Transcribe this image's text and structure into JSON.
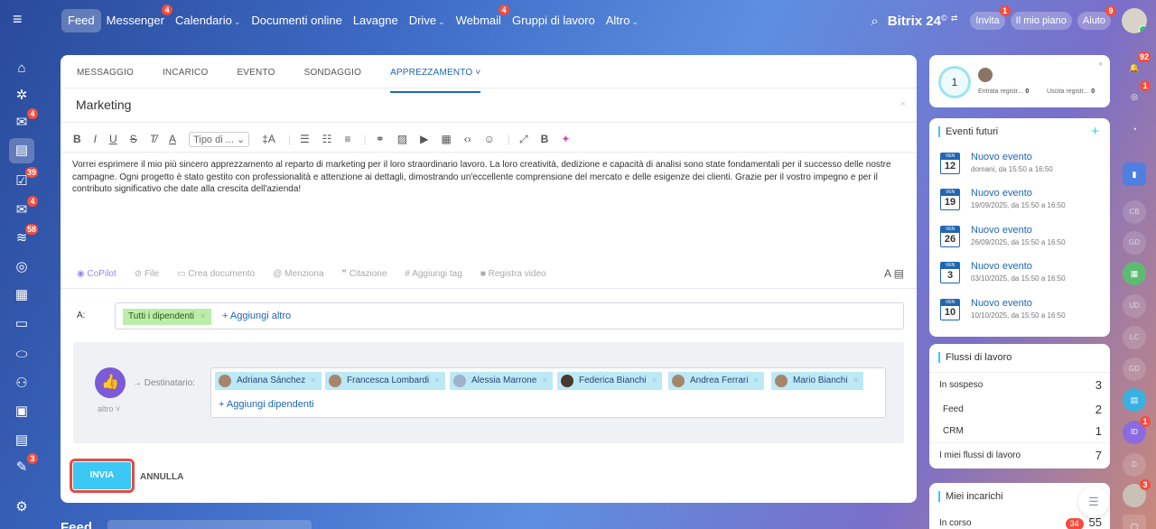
{
  "topbar": {
    "nav": [
      {
        "label": "Feed",
        "active": true
      },
      {
        "label": "Messenger",
        "badge": "4"
      },
      {
        "label": "Calendario",
        "chevron": true
      },
      {
        "label": "Documenti online"
      },
      {
        "label": "Lavagne"
      },
      {
        "label": "Drive",
        "chevron": true
      },
      {
        "label": "Webmail",
        "badge": "4"
      },
      {
        "label": "Gruppi di lavoro"
      },
      {
        "label": "Altro",
        "chevron": true
      }
    ],
    "brand": "Bitrix 24",
    "brand_sup": "©",
    "invite": "Invita",
    "invite_badge": "1",
    "plan": "Il mio piano",
    "help": "Aiuto",
    "help_badge": "9"
  },
  "leftrail": {
    "badges": {
      "tasks": "4",
      "cal": "39",
      "mail": "4",
      "flow": "58",
      "bottom": "3"
    }
  },
  "post": {
    "tabs": [
      "MESSAGGIO",
      "INCARICO",
      "EVENTO",
      "SONDAGGIO",
      "APPREZZAMENTO"
    ],
    "active_tab_caret": "˅",
    "title": "Marketing",
    "toolbar": {
      "bold": "B",
      "italic": "I",
      "underline": "U",
      "strike": "S",
      "clear": "T̸",
      "color": "A",
      "style": "Tipo di ...",
      "size": "‡A"
    },
    "body": "Vorrei esprimere il mio più sincero apprezzamento al reparto di marketing per il loro straordinario lavoro. La loro creatività, dedizione e capacità di analisi sono state fondamentali per il successo delle nostre campagne. Ogni progetto è stato gestito con professionalità e attenzione ai dettagli, dimostrando un'eccellente comprensione del mercato e delle esigenze dei clienti. Grazie per il vostro impegno e per il contributo significativo che date alla crescita dell'azienda!",
    "attach": [
      "CoPilot",
      "File",
      "Crea documento",
      "Menziona",
      "Citazione",
      "Aggiungi tag",
      "Registra video"
    ],
    "to_label": "A:",
    "to_chip": "Tutti i dipendenti",
    "to_add": "+ Aggiungi altro",
    "badge_label": "altro",
    "recipient_label": "Destinatario:",
    "recipients": [
      "Adriana Sánchez",
      "Francesca Lombardi",
      "Alessia Marrone",
      "Federica Bianchi",
      "Andrea Ferrari",
      "Mario Bianchi"
    ],
    "add_employees": "+ Aggiungi dipendenti",
    "send": "INVIA",
    "cancel": "ANNULLA"
  },
  "feed_title": "Feed",
  "side": {
    "timeman": {
      "count": "1",
      "in_label": "Entrata registr...",
      "in_val": "0",
      "out_label": "Uscita registr...",
      "out_val": "0"
    },
    "events_title": "Eventi futuri",
    "events": [
      {
        "day": "VEN",
        "num": "12",
        "title": "Nuovo evento",
        "sub": "domani, da 15:50 a 16:50"
      },
      {
        "day": "VEN",
        "num": "19",
        "title": "Nuovo evento",
        "sub": "19/09/2025, da 15:50 a 16:50"
      },
      {
        "day": "VEN",
        "num": "26",
        "title": "Nuovo evento",
        "sub": "26/09/2025, da 15:50 a 16:50"
      },
      {
        "day": "VEN",
        "num": "3",
        "title": "Nuovo evento",
        "sub": "03/10/2025, da 15:50 a 16:50"
      },
      {
        "day": "VEN",
        "num": "10",
        "title": "Nuovo evento",
        "sub": "10/10/2025, da 15:50 a 16:50"
      }
    ],
    "workflows_title": "Flussi di lavoro",
    "workflows": [
      {
        "label": "In sospeso",
        "value": "3"
      },
      {
        "label": "Feed",
        "value": "2"
      },
      {
        "label": "CRM",
        "value": "1"
      },
      {
        "label": "I miei flussi di lavoro",
        "value": "7"
      }
    ],
    "tasks_title": "Miei incarichi",
    "tasks_row": {
      "label": "In corso",
      "badge": "34",
      "value": "55"
    }
  },
  "rightrail": {
    "bell_badge": "92",
    "copilot_badge": "1",
    "id_badge": "1",
    "ava_badge": "3",
    "initials": [
      "CB",
      "GD",
      "UD",
      "LC",
      "GD",
      "ID",
      "D"
    ]
  }
}
